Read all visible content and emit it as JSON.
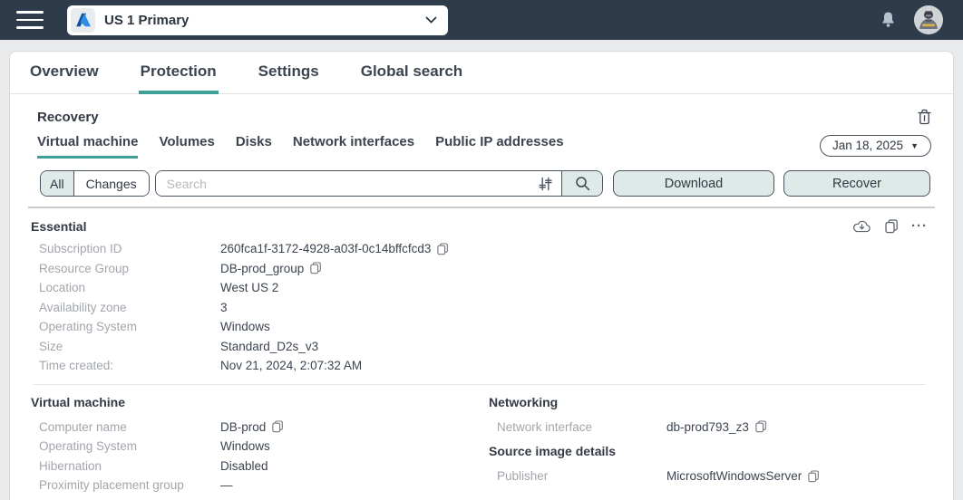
{
  "topbar": {
    "scope_selector_label": "US 1 Primary"
  },
  "tabs": [
    {
      "label": "Overview",
      "active": false
    },
    {
      "label": "Protection",
      "active": true
    },
    {
      "label": "Settings",
      "active": false
    },
    {
      "label": "Global search",
      "active": false
    }
  ],
  "recovery": {
    "title": "Recovery",
    "subtabs": [
      {
        "label": "Virtual machine",
        "active": true
      },
      {
        "label": "Volumes",
        "active": false
      },
      {
        "label": "Disks",
        "active": false
      },
      {
        "label": "Network interfaces",
        "active": false
      },
      {
        "label": "Public IP addresses",
        "active": false
      }
    ],
    "date_selector": "Jan 18, 2025",
    "toolbar": {
      "segments": [
        {
          "label": "All",
          "active": true
        },
        {
          "label": "Changes",
          "active": false
        }
      ],
      "search_placeholder": "Search",
      "download_label": "Download",
      "recover_label": "Recover"
    }
  },
  "essential": {
    "title": "Essential",
    "rows": [
      {
        "label": "Subscription ID",
        "value": "260fca1f-3172-4928-a03f-0c14bffcfcd3",
        "copyable": true
      },
      {
        "label": "Resource Group",
        "value": "DB-prod_group",
        "copyable": true
      },
      {
        "label": "Location",
        "value": "West US 2",
        "copyable": false
      },
      {
        "label": "Availability zone",
        "value": "3",
        "copyable": false
      },
      {
        "label": "Operating System",
        "value": "Windows",
        "copyable": false
      },
      {
        "label": "Size",
        "value": "Standard_D2s_v3",
        "copyable": false
      },
      {
        "label": "Time created:",
        "value": "Nov 21, 2024, 2:07:32 AM",
        "copyable": false
      }
    ]
  },
  "virtual_machine": {
    "title": "Virtual machine",
    "rows": [
      {
        "label": "Computer name",
        "value": "DB-prod",
        "copyable": true
      },
      {
        "label": "Operating System",
        "value": "Windows",
        "copyable": false
      },
      {
        "label": "Hibernation",
        "value": "Disabled",
        "copyable": false
      },
      {
        "label": "Proximity placement group",
        "value": "—",
        "copyable": false
      }
    ]
  },
  "networking": {
    "title": "Networking",
    "rows": [
      {
        "label": "Network interface",
        "value": "db-prod793_z3",
        "copyable": true
      }
    ]
  },
  "source_image_details": {
    "title": "Source image details",
    "rows": [
      {
        "label": "Publisher",
        "value": "MicrosoftWindowsServer",
        "copyable": true
      }
    ]
  },
  "icons": {
    "ellipsis": "···"
  },
  "colors": {
    "topbar": "#2e3b4a",
    "accent_teal": "#3f9f97",
    "button_fill": "#dfe9e7",
    "button_border": "#49545f"
  }
}
